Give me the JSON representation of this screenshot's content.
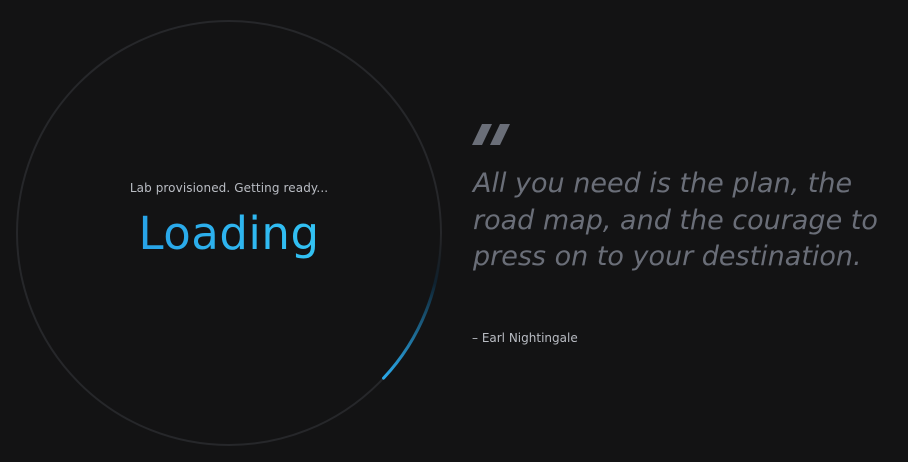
{
  "loader": {
    "status_text": "Lab provisioned. Getting ready...",
    "title": "Loading",
    "progress": 0.12,
    "colors": {
      "track": "#2a2b2e",
      "arc_start": "#0b1a24",
      "arc_end": "#2aa8e8",
      "title_gradient": [
        "#1f8bdc",
        "#38d4f7"
      ]
    }
  },
  "quote": {
    "mark_icon": "quote-icon",
    "text": "All you need is the plan, the road map, and the courage to press on to your destination.",
    "author": "– Earl Nightingale",
    "colors": {
      "text": "#6a6e78",
      "mark": "#6a6e78"
    }
  },
  "background": "#131314"
}
